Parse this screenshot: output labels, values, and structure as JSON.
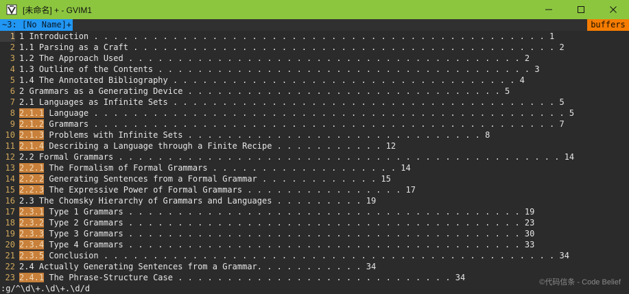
{
  "window": {
    "title": "[未命名] + - GVIM1",
    "buttons": [
      "minimize",
      "maximize",
      "close"
    ]
  },
  "tabline": {
    "current_tab": "~3: [No Name]+",
    "buffers_label": "buffers",
    "colors": {
      "current_tab_bg": "#2196f3",
      "buffers_bg": "#f57c00"
    }
  },
  "editor": {
    "current_line": 1,
    "lines": [
      {
        "num": "1",
        "prefix": "",
        "text": "1 Introduction . . . . . . . . . . . . . . . . . . . . . . . . . . . . . . . . . . . . . . . . . . . . . . 1"
      },
      {
        "num": "2",
        "prefix": "",
        "text": "1.1 Parsing as a Craft . . . . . . . . . . . . . . . . . . . . . . . . . . . . . . . . . . . . . . . . . . . 2"
      },
      {
        "num": "3",
        "prefix": "",
        "text": "1.2 The Approach Used . . . . . . . . . . . . . . . . . . . . . . . . . . . . . . . . . . . . . . . . 2"
      },
      {
        "num": "4",
        "prefix": "",
        "text": "1.3 Outline of the Contents . . . . . . . . . . . . . . . . . . . . . . . . . . . . . . . . . . . . . . 3"
      },
      {
        "num": "5",
        "prefix": "",
        "text": "1.4 The Annotated Bibliography . . . . . . . . . . . . . . . . . . . . . . . . . . . . . . . . . . . 4"
      },
      {
        "num": "6",
        "prefix": "",
        "text": "2 Grammars as a Generating Device . . . . . . . . . . . . . . . . . . . . . . . . . . . . . . . . 5"
      },
      {
        "num": "7",
        "prefix": "",
        "text": "2.1 Languages as Infinite Sets . . . . . . . . . . . . . . . . . . . . . . . . . . . . . . . . . . . . . . . 5"
      },
      {
        "num": "8",
        "prefix": "2.1.1",
        "text": " Language . . . . . . . . . . . . . . . . . . . . . . . . . . . . . . . . . . . . . . . . . . . . . . . . 5"
      },
      {
        "num": "9",
        "prefix": "2.1.2",
        "text": " Grammars . . . . . . . . . . . . . . . . . . . . . . . . . . . . . . . . . . . . . . . . . . . . . . . 7"
      },
      {
        "num": "10",
        "prefix": "2.1.3",
        "text": " Problems with Infinite Sets . . . . . . . . . . . . . . . . . . . . . . . . . . . . . . 8"
      },
      {
        "num": "11",
        "prefix": "2.1.4",
        "text": " Describing a Language through a Finite Recipe . . . . . . . . . . . 12"
      },
      {
        "num": "12",
        "prefix": "",
        "text": "2.2 Formal Grammars . . . . . . . . . . . . . . . . . . . . . . . . . . . . . . . . . . . . . . . . . . . . . 14"
      },
      {
        "num": "13",
        "prefix": "2.2.1",
        "text": " The Formalism of Formal Grammars . . . . . . . . . . . . . . . . . . . 14"
      },
      {
        "num": "14",
        "prefix": "2.2.2",
        "text": " Generating Sentences from a Formal Grammar . . . . . . . . . . . . 15"
      },
      {
        "num": "15",
        "prefix": "2.2.3",
        "text": " The Expressive Power of Formal Grammars . . . . . . . . . . . . . . . . 17"
      },
      {
        "num": "16",
        "prefix": "",
        "text": "2.3 The Chomsky Hierarchy of Grammars and Languages . . . . . . . . . 19"
      },
      {
        "num": "17",
        "prefix": "2.3.1",
        "text": " Type 1 Grammars . . . . . . . . . . . . . . . . . . . . . . . . . . . . . . . . . . . . . . . . 19"
      },
      {
        "num": "18",
        "prefix": "2.3.2",
        "text": " Type 2 Grammars . . . . . . . . . . . . . . . . . . . . . . . . . . . . . . . . . . . . . . . . 23"
      },
      {
        "num": "19",
        "prefix": "2.3.3",
        "text": " Type 3 Grammars . . . . . . . . . . . . . . . . . . . . . . . . . . . . . . . . . . . . . . . . 30"
      },
      {
        "num": "20",
        "prefix": "2.3.4",
        "text": " Type 4 Grammars . . . . . . . . . . . . . . . . . . . . . . . . . . . . . . . . . . . . . . . . 33"
      },
      {
        "num": "21",
        "prefix": "2.3.5",
        "text": " Conclusion . . . . . . . . . . . . . . . . . . . . . . . . . . . . . . . . . . . . . . . . . . . . . . 34"
      },
      {
        "num": "22",
        "prefix": "",
        "text": "2.4 Actually Generating Sentences from a Grammar. . . . . . . . . . . 34"
      },
      {
        "num": "23",
        "prefix": "2.4.1",
        "text": " The Phrase-Structure Case . . . . . . . . . . . . . . . . . . . . . . . . . . . . 34"
      }
    ],
    "colors": {
      "background": "#2b2b2b",
      "line_number": "#d0a85c",
      "match_highlight": "#c8803a"
    }
  },
  "cmdline": {
    "text": ":g/^\\d\\+.\\d\\+.\\d/d"
  },
  "watermark": {
    "text": "©代码信条 - Code Belief"
  }
}
